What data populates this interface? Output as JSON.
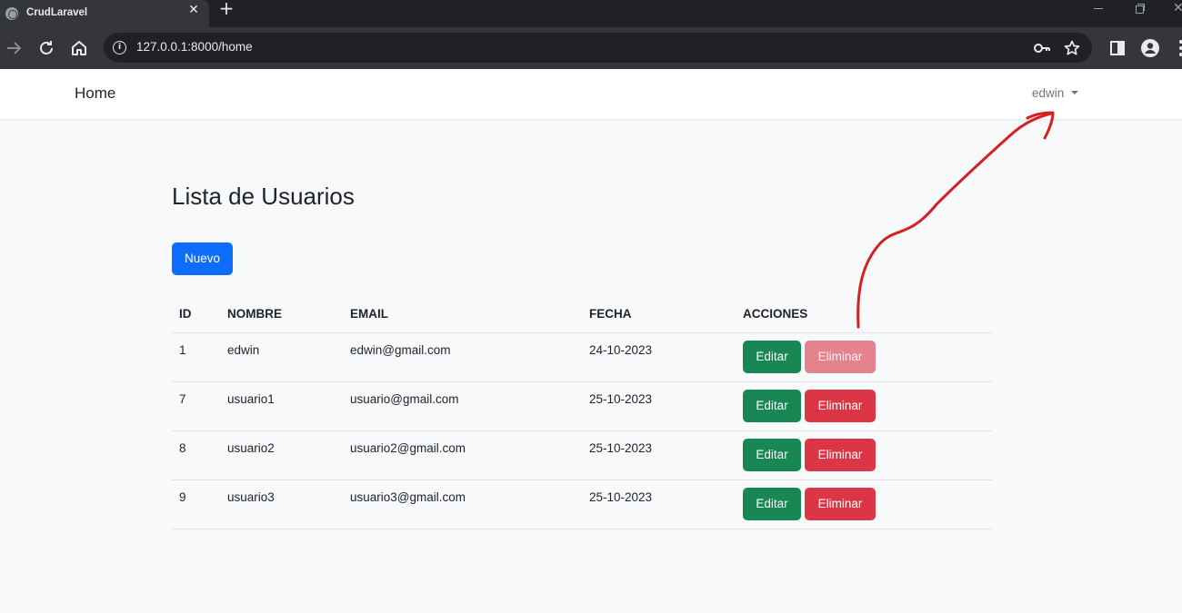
{
  "browser": {
    "tab_title": "CrudLaravel",
    "tab_close": "✕",
    "new_tab": "+",
    "url": "127.0.0.1:8000/home"
  },
  "navbar": {
    "brand": "Home",
    "user": "edwin"
  },
  "page": {
    "title": "Lista de Usuarios",
    "new_button": "Nuevo"
  },
  "table": {
    "headers": [
      "ID",
      "NOMBRE",
      "EMAIL",
      "FECHA",
      "ACCIONES"
    ],
    "rows": [
      {
        "id": "1",
        "nombre": "edwin",
        "email": "edwin@gmail.com",
        "fecha": "24-10-2023",
        "edit": "Editar",
        "delete": "Eliminar",
        "delete_disabled": true
      },
      {
        "id": "7",
        "nombre": "usuario1",
        "email": "usuario@gmail.com",
        "fecha": "25-10-2023",
        "edit": "Editar",
        "delete": "Eliminar",
        "delete_disabled": false
      },
      {
        "id": "8",
        "nombre": "usuario2",
        "email": "usuario2@gmail.com",
        "fecha": "25-10-2023",
        "edit": "Editar",
        "delete": "Eliminar",
        "delete_disabled": false
      },
      {
        "id": "9",
        "nombre": "usuario3",
        "email": "usuario3@gmail.com",
        "fecha": "25-10-2023",
        "edit": "Editar",
        "delete": "Eliminar",
        "delete_disabled": false
      }
    ]
  },
  "colors": {
    "primary": "#0d6efd",
    "success": "#198754",
    "danger": "#dc3545",
    "annotation": "#d62020"
  }
}
